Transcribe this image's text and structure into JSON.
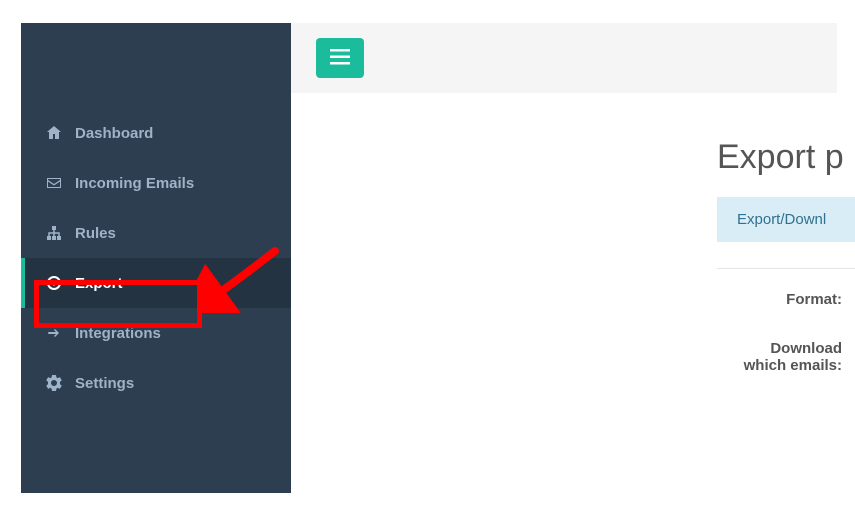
{
  "sidebar": {
    "items": [
      {
        "label": "Dashboard"
      },
      {
        "label": "Incoming Emails"
      },
      {
        "label": "Rules"
      },
      {
        "label": "Export"
      },
      {
        "label": "Integrations"
      },
      {
        "label": "Settings"
      }
    ]
  },
  "main": {
    "title": "Export p",
    "tab_label": "Export/Downl",
    "field_format": "Format:",
    "field_download": "Download which emails:"
  }
}
